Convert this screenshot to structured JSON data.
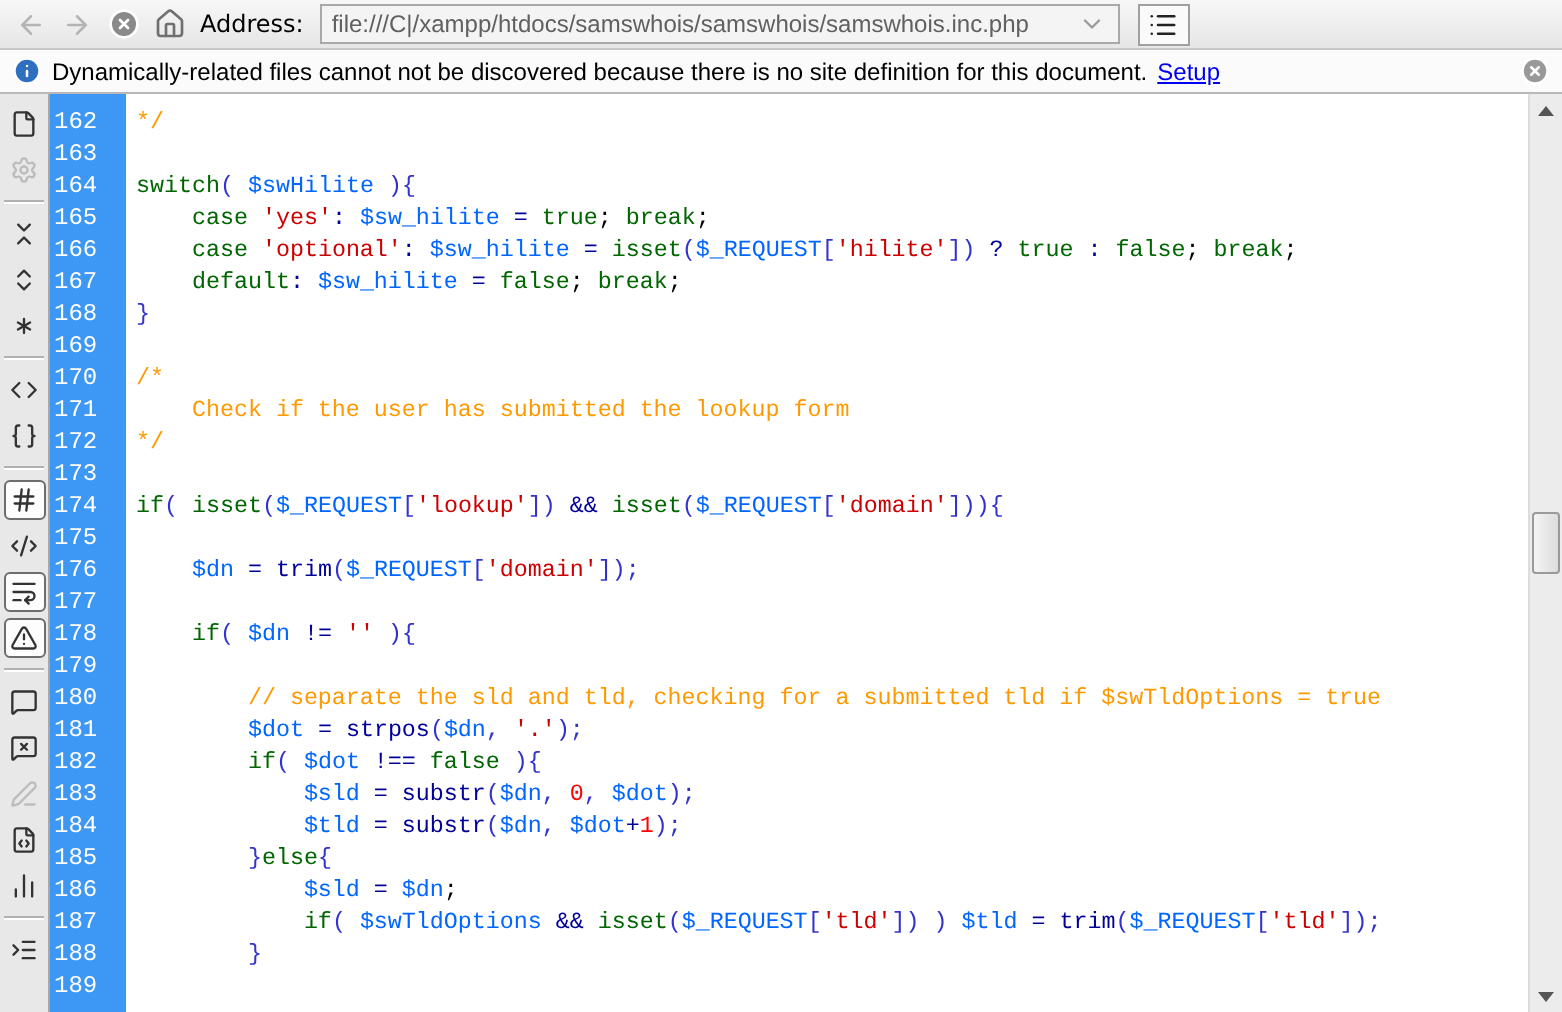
{
  "toolbar": {
    "back": {
      "disabled": true
    },
    "forward": {
      "disabled": true
    },
    "address_label": "Address:",
    "address": "file:///C|/xampp/htdocs/samswhois/samswhois/samswhois.inc.php"
  },
  "info_bar": {
    "message": "Dynamically-related files cannot not be discovered because there is no site definition for this document.",
    "link": "Setup"
  },
  "side_tools": [
    {
      "kind": "button",
      "pressed": false,
      "disabled": false
    },
    {
      "kind": "button",
      "pressed": false,
      "disabled": true
    },
    {
      "kind": "separator"
    },
    {
      "kind": "button",
      "pressed": false,
      "disabled": false
    },
    {
      "kind": "button",
      "pressed": false,
      "disabled": false
    },
    {
      "kind": "button",
      "pressed": false,
      "disabled": false
    },
    {
      "kind": "separator"
    },
    {
      "kind": "button",
      "pressed": false,
      "disabled": false
    },
    {
      "kind": "button",
      "pressed": false,
      "disabled": false
    },
    {
      "kind": "separator"
    },
    {
      "kind": "button",
      "pressed": true,
      "disabled": false
    },
    {
      "kind": "button",
      "pressed": false,
      "disabled": false
    },
    {
      "kind": "button",
      "pressed": true,
      "disabled": false
    },
    {
      "kind": "button",
      "pressed": true,
      "disabled": false
    },
    {
      "kind": "separator"
    },
    {
      "kind": "button",
      "pressed": false,
      "disabled": false
    },
    {
      "kind": "button",
      "pressed": false,
      "disabled": false
    },
    {
      "kind": "button",
      "pressed": false,
      "disabled": true
    },
    {
      "kind": "button",
      "pressed": false,
      "disabled": false
    },
    {
      "kind": "button",
      "pressed": false,
      "disabled": false
    },
    {
      "kind": "separator"
    },
    {
      "kind": "button",
      "pressed": false,
      "disabled": false
    }
  ],
  "code_lines": [
    {
      "number": "162",
      "tokens": [
        {
          "kind": "com",
          "text": "*/"
        }
      ]
    },
    {
      "number": "163"
    },
    {
      "number": "164",
      "tokens": [
        {
          "kind": "kw",
          "text": "switch"
        },
        {
          "kind": "punc",
          "text": "( "
        },
        {
          "kind": "var",
          "text": "$swHilite"
        },
        {
          "kind": "punc",
          "text": " ){"
        }
      ]
    },
    {
      "number": "165",
      "tokens": [
        {
          "kind": "kw",
          "text": "    case "
        },
        {
          "kind": "str",
          "text": "'yes'"
        },
        {
          "kind": "op",
          "text": ": "
        },
        {
          "kind": "var",
          "text": "$sw_hilite"
        },
        {
          "kind": "op",
          "text": " = "
        },
        {
          "kind": "kw",
          "text": "true"
        },
        {
          "kind": "plain",
          "text": "; "
        },
        {
          "kind": "kw",
          "text": "break"
        },
        {
          "kind": "plain",
          "text": ";"
        }
      ]
    },
    {
      "number": "166",
      "tokens": [
        {
          "kind": "kw",
          "text": "    case "
        },
        {
          "kind": "str",
          "text": "'optional'"
        },
        {
          "kind": "op",
          "text": ": "
        },
        {
          "kind": "var",
          "text": "$sw_hilite"
        },
        {
          "kind": "op",
          "text": " = "
        },
        {
          "kind": "kw",
          "text": "isset"
        },
        {
          "kind": "punc",
          "text": "("
        },
        {
          "kind": "var",
          "text": "$_REQUEST"
        },
        {
          "kind": "punc",
          "text": "["
        },
        {
          "kind": "str",
          "text": "'hilite'"
        },
        {
          "kind": "punc",
          "text": "]) "
        },
        {
          "kind": "op",
          "text": "? "
        },
        {
          "kind": "kw",
          "text": "true"
        },
        {
          "kind": "op",
          "text": " : "
        },
        {
          "kind": "kw",
          "text": "false"
        },
        {
          "kind": "plain",
          "text": "; "
        },
        {
          "kind": "kw",
          "text": "break"
        },
        {
          "kind": "plain",
          "text": ";"
        }
      ]
    },
    {
      "number": "167",
      "tokens": [
        {
          "kind": "kw",
          "text": "    default"
        },
        {
          "kind": "op",
          "text": ": "
        },
        {
          "kind": "var",
          "text": "$sw_hilite"
        },
        {
          "kind": "op",
          "text": " = "
        },
        {
          "kind": "kw",
          "text": "false"
        },
        {
          "kind": "plain",
          "text": "; "
        },
        {
          "kind": "kw",
          "text": "break"
        },
        {
          "kind": "plain",
          "text": ";"
        }
      ]
    },
    {
      "number": "168",
      "tokens": [
        {
          "kind": "punc",
          "text": "}"
        }
      ]
    },
    {
      "number": "169"
    },
    {
      "number": "170",
      "tokens": [
        {
          "kind": "com",
          "text": "/*"
        }
      ]
    },
    {
      "number": "171",
      "tokens": [
        {
          "kind": "com",
          "text": "    Check if the user has submitted the lookup form"
        }
      ]
    },
    {
      "number": "172",
      "tokens": [
        {
          "kind": "com",
          "text": "*/"
        }
      ]
    },
    {
      "number": "173"
    },
    {
      "number": "174",
      "tokens": [
        {
          "kind": "kw",
          "text": "if"
        },
        {
          "kind": "punc",
          "text": "( "
        },
        {
          "kind": "kw",
          "text": "isset"
        },
        {
          "kind": "punc",
          "text": "("
        },
        {
          "kind": "var",
          "text": "$_REQUEST"
        },
        {
          "kind": "punc",
          "text": "["
        },
        {
          "kind": "str",
          "text": "'lookup'"
        },
        {
          "kind": "punc",
          "text": "]) "
        },
        {
          "kind": "op",
          "text": "&& "
        },
        {
          "kind": "kw",
          "text": "isset"
        },
        {
          "kind": "punc",
          "text": "("
        },
        {
          "kind": "var",
          "text": "$_REQUEST"
        },
        {
          "kind": "punc",
          "text": "["
        },
        {
          "kind": "str",
          "text": "'domain'"
        },
        {
          "kind": "punc",
          "text": "])){"
        }
      ]
    },
    {
      "number": "175"
    },
    {
      "number": "176",
      "tokens": [
        {
          "kind": "var",
          "text": "    $dn"
        },
        {
          "kind": "op",
          "text": " = "
        },
        {
          "kind": "fn",
          "text": "trim"
        },
        {
          "kind": "punc",
          "text": "("
        },
        {
          "kind": "var",
          "text": "$_REQUEST"
        },
        {
          "kind": "punc",
          "text": "["
        },
        {
          "kind": "str",
          "text": "'domain'"
        },
        {
          "kind": "punc",
          "text": "]);"
        }
      ]
    },
    {
      "number": "177"
    },
    {
      "number": "178",
      "tokens": [
        {
          "kind": "kw",
          "text": "    if"
        },
        {
          "kind": "punc",
          "text": "( "
        },
        {
          "kind": "var",
          "text": "$dn"
        },
        {
          "kind": "op",
          "text": " != "
        },
        {
          "kind": "str",
          "text": "''"
        },
        {
          "kind": "punc",
          "text": " ){"
        }
      ]
    },
    {
      "number": "179"
    },
    {
      "number": "180",
      "tokens": [
        {
          "kind": "com",
          "text": "        // separate the sld and tld, checking for a submitted tld if $swTldOptions = true"
        }
      ]
    },
    {
      "number": "181",
      "tokens": [
        {
          "kind": "var",
          "text": "        $dot"
        },
        {
          "kind": "op",
          "text": " = "
        },
        {
          "kind": "fn",
          "text": "strpos"
        },
        {
          "kind": "punc",
          "text": "("
        },
        {
          "kind": "var",
          "text": "$dn"
        },
        {
          "kind": "punc",
          "text": ", "
        },
        {
          "kind": "str",
          "text": "'.'"
        },
        {
          "kind": "punc",
          "text": ");"
        }
      ]
    },
    {
      "number": "182",
      "tokens": [
        {
          "kind": "kw",
          "text": "        if"
        },
        {
          "kind": "punc",
          "text": "( "
        },
        {
          "kind": "var",
          "text": "$dot"
        },
        {
          "kind": "op",
          "text": " !== "
        },
        {
          "kind": "kw",
          "text": "false"
        },
        {
          "kind": "punc",
          "text": " ){"
        }
      ]
    },
    {
      "number": "183",
      "tokens": [
        {
          "kind": "var",
          "text": "            $sld"
        },
        {
          "kind": "op",
          "text": " = "
        },
        {
          "kind": "fn",
          "text": "substr"
        },
        {
          "kind": "punc",
          "text": "("
        },
        {
          "kind": "var",
          "text": "$dn"
        },
        {
          "kind": "punc",
          "text": ", "
        },
        {
          "kind": "num",
          "text": "0"
        },
        {
          "kind": "punc",
          "text": ", "
        },
        {
          "kind": "var",
          "text": "$dot"
        },
        {
          "kind": "punc",
          "text": ");"
        }
      ]
    },
    {
      "number": "184",
      "tokens": [
        {
          "kind": "var",
          "text": "            $tld"
        },
        {
          "kind": "op",
          "text": " = "
        },
        {
          "kind": "fn",
          "text": "substr"
        },
        {
          "kind": "punc",
          "text": "("
        },
        {
          "kind": "var",
          "text": "$dn"
        },
        {
          "kind": "punc",
          "text": ", "
        },
        {
          "kind": "var",
          "text": "$dot"
        },
        {
          "kind": "op",
          "text": "+"
        },
        {
          "kind": "num",
          "text": "1"
        },
        {
          "kind": "punc",
          "text": ");"
        }
      ]
    },
    {
      "number": "185",
      "tokens": [
        {
          "kind": "punc",
          "text": "        }"
        },
        {
          "kind": "kw",
          "text": "else"
        },
        {
          "kind": "punc",
          "text": "{"
        }
      ]
    },
    {
      "number": "186",
      "tokens": [
        {
          "kind": "var",
          "text": "            $sld"
        },
        {
          "kind": "op",
          "text": " = "
        },
        {
          "kind": "var",
          "text": "$dn"
        },
        {
          "kind": "plain",
          "text": ";"
        }
      ]
    },
    {
      "number": "187",
      "tokens": [
        {
          "kind": "kw",
          "text": "            if"
        },
        {
          "kind": "punc",
          "text": "( "
        },
        {
          "kind": "var",
          "text": "$swTldOptions"
        },
        {
          "kind": "op",
          "text": " && "
        },
        {
          "kind": "kw",
          "text": "isset"
        },
        {
          "kind": "punc",
          "text": "("
        },
        {
          "kind": "var",
          "text": "$_REQUEST"
        },
        {
          "kind": "punc",
          "text": "["
        },
        {
          "kind": "str",
          "text": "'tld'"
        },
        {
          "kind": "punc",
          "text": "]) ) "
        },
        {
          "kind": "var",
          "text": "$tld"
        },
        {
          "kind": "op",
          "text": " = "
        },
        {
          "kind": "fn",
          "text": "trim"
        },
        {
          "kind": "punc",
          "text": "("
        },
        {
          "kind": "var",
          "text": "$_REQUEST"
        },
        {
          "kind": "punc",
          "text": "["
        },
        {
          "kind": "str",
          "text": "'tld'"
        },
        {
          "kind": "punc",
          "text": "]);"
        }
      ]
    },
    {
      "number": "188",
      "tokens": [
        {
          "kind": "punc",
          "text": "        }"
        }
      ]
    },
    {
      "number": "189"
    }
  ]
}
